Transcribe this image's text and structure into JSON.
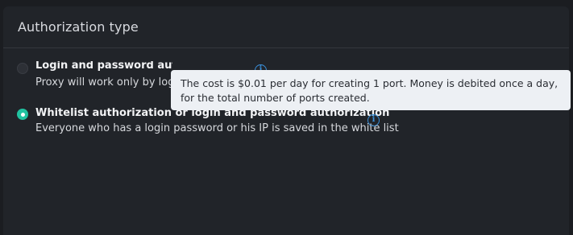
{
  "panel": {
    "title": "Authorization type"
  },
  "options": [
    {
      "title": "Login and password authorization",
      "description": "Proxy will work only by login and password",
      "selected": false
    },
    {
      "title": "Whitelist authorization or login and password authorization",
      "description": "Everyone who has a login password or his IP is saved in the white list",
      "selected": true
    }
  ],
  "tooltip": {
    "line1": "The cost is $0.01 per day for creating 1 port. Money is debited once a day,",
    "line2": "for the total number of ports created."
  },
  "colors": {
    "background": "#1b1d21",
    "panel": "#212429",
    "accent_selected": "#20c2a0",
    "info_icon": "#3a8fd9",
    "tooltip_bg": "#edf0f4"
  }
}
